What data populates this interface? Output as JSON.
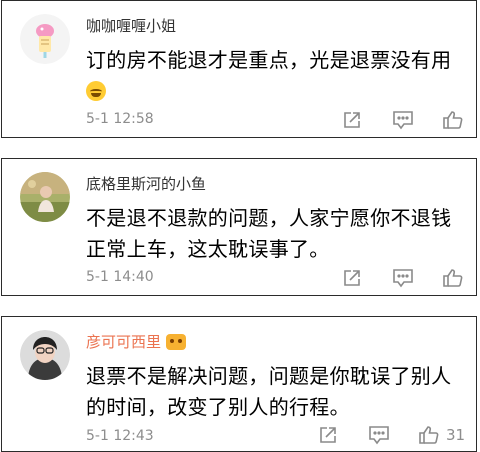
{
  "comments": [
    {
      "name": "咖咖喱喱小姐",
      "avatar_icon": "ice-cream-avatar-icon",
      "text_before_emoji": "订的房不能退才是重点，光是退票没有用",
      "emoji_icon": "laughing-tears-emoji-icon",
      "time": "5-1 12:58",
      "like_count": ""
    },
    {
      "name": "底格里斯河的小鱼",
      "avatar_icon": "photo-avatar-icon",
      "text": "不是退不退款的问题，人家宁愿你不退钱正常上车，这太耽误事了。",
      "time": "5-1 14:40",
      "like_count": ""
    },
    {
      "name": "彦可可西里",
      "name_color": "#eb7350",
      "badge_icon": "vip-crown-badge-icon",
      "avatar_icon": "selfie-avatar-icon",
      "text": "退票不是解决问题，问题是你耽误了别人的时间，改变了别人的行程。",
      "time": "5-1 12:43",
      "like_count": "31"
    }
  ],
  "actions": {
    "share_icon": "share-icon",
    "comment_icon": "comment-icon",
    "like_icon": "thumbs-up-icon"
  },
  "colors": {
    "meta_gray": "#8d8d8d",
    "vip_name": "#eb7350",
    "border": "#2b2b2b"
  }
}
